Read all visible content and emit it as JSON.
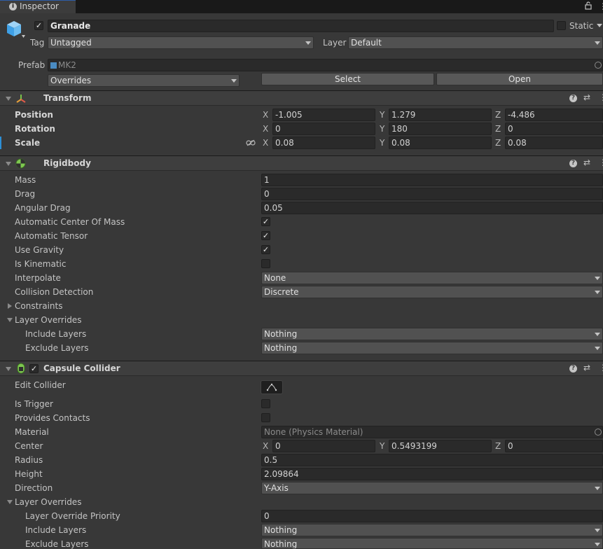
{
  "tab": {
    "title": "Inspector",
    "info_icon": "info-icon",
    "lock_icon": "lock-icon",
    "menu_icon": "kebab-menu-icon"
  },
  "gameobject": {
    "active": true,
    "name": "Granade",
    "static_label": "Static",
    "static": false,
    "tag_label": "Tag",
    "tag_value": "Untagged",
    "layer_label": "Layer",
    "layer_value": "Default",
    "prefab_label": "Prefab",
    "prefab_value": "MK2",
    "overrides_value": "Overrides",
    "select_label": "Select",
    "open_label": "Open"
  },
  "transform": {
    "title": "Transform",
    "position": {
      "label": "Position",
      "x": "-1.005",
      "y": "1.279",
      "z": "-4.486"
    },
    "rotation": {
      "label": "Rotation",
      "x": "0",
      "y": "180",
      "z": "0"
    },
    "scale": {
      "label": "Scale",
      "x": "0.08",
      "y": "0.08",
      "z": "0.08"
    },
    "axis_x": "X",
    "axis_y": "Y",
    "axis_z": "Z"
  },
  "rigidbody": {
    "title": "Rigidbody",
    "mass": {
      "label": "Mass",
      "value": "1"
    },
    "drag": {
      "label": "Drag",
      "value": "0"
    },
    "angular_drag": {
      "label": "Angular Drag",
      "value": "0.05"
    },
    "auto_center": {
      "label": "Automatic Center Of Mass",
      "checked": true
    },
    "auto_tensor": {
      "label": "Automatic Tensor",
      "checked": true
    },
    "use_gravity": {
      "label": "Use Gravity",
      "checked": true
    },
    "is_kinematic": {
      "label": "Is Kinematic",
      "checked": false
    },
    "interpolate": {
      "label": "Interpolate",
      "value": "None"
    },
    "collision_detection": {
      "label": "Collision Detection",
      "value": "Discrete"
    },
    "constraints_label": "Constraints",
    "layer_overrides_label": "Layer Overrides",
    "include_layers": {
      "label": "Include Layers",
      "value": "Nothing"
    },
    "exclude_layers": {
      "label": "Exclude Layers",
      "value": "Nothing"
    }
  },
  "capsule": {
    "title": "Capsule Collider",
    "enabled": true,
    "edit_collider_label": "Edit Collider",
    "is_trigger": {
      "label": "Is Trigger",
      "checked": false
    },
    "provides_contacts": {
      "label": "Provides Contacts",
      "checked": false
    },
    "material": {
      "label": "Material",
      "value": "None (Physics Material)"
    },
    "center": {
      "label": "Center",
      "x": "0",
      "y": "0.5493199",
      "z": "0"
    },
    "radius": {
      "label": "Radius",
      "value": "0.5"
    },
    "height": {
      "label": "Height",
      "value": "2.09864"
    },
    "direction": {
      "label": "Direction",
      "value": "Y-Axis"
    },
    "layer_overrides_label": "Layer Overrides",
    "priority": {
      "label": "Layer Override Priority",
      "value": "0"
    },
    "include_layers": {
      "label": "Include Layers",
      "value": "Nothing"
    },
    "exclude_layers": {
      "label": "Exclude Layers",
      "value": "Nothing"
    }
  },
  "colors": {
    "background": "#383838",
    "header": "#3e3e3e",
    "field": "#2a2a2a",
    "dropdown": "#515151",
    "accent": "#2d8fd6"
  }
}
